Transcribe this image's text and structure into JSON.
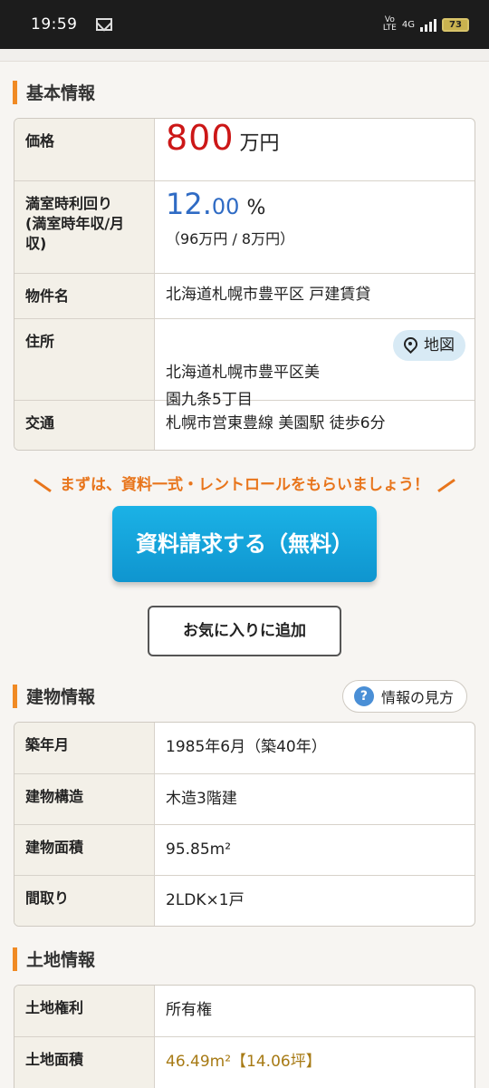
{
  "status_bar": {
    "time": "19:59",
    "volte": "Vo\nLTE",
    "network": "4G",
    "battery": "73"
  },
  "basic_info": {
    "heading": "基本情報",
    "rows": {
      "price": {
        "label": "価格",
        "number": "800",
        "unit": "万円"
      },
      "yield": {
        "label": "満室時利回り\n(満室時年収/月収)",
        "int": "12.",
        "dec": "00",
        "pct": "%",
        "sub": "（96万円 / 8万円）"
      },
      "name": {
        "label": "物件名",
        "value": "北海道札幌市豊平区 戸建賃貸"
      },
      "address": {
        "label": "住所",
        "value": "北海道札幌市豊平区美\n園九条5丁目",
        "map_label": "地図"
      },
      "transit": {
        "label": "交通",
        "value": "札幌市営東豊線 美園駅 徒歩6分"
      }
    }
  },
  "cta": {
    "note": "まずは、資料一式・レントロールをもらいましょう！",
    "request_button": "資料請求する（無料）",
    "favorite_button": "お気に入りに追加"
  },
  "building_info": {
    "heading": "建物情報",
    "help_label": "情報の見方",
    "rows": [
      {
        "label": "築年月",
        "value": "1985年6月（築40年）"
      },
      {
        "label": "建物構造",
        "value": "木造3階建"
      },
      {
        "label": "建物面積",
        "value": "95.85m²"
      },
      {
        "label": "間取り",
        "value": "2LDK×1戸"
      }
    ]
  },
  "land_info": {
    "heading": "土地情報",
    "rows": [
      {
        "label": "土地権利",
        "value": "所有権"
      },
      {
        "label": "土地面積",
        "value": "46.49m²【14.06坪】"
      }
    ]
  },
  "colors": {
    "accent": "#f08a24",
    "price": "#cc1717",
    "yield": "#2f6bc4",
    "cta": "#e8751c",
    "button": "#1bb2e6"
  }
}
